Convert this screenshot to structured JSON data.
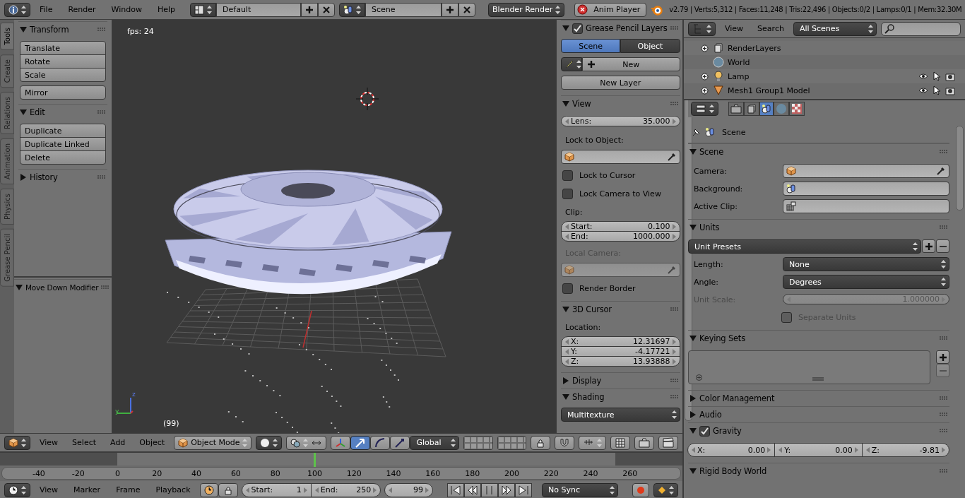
{
  "top_bar": {
    "menus": [
      "File",
      "Render",
      "Window",
      "Help"
    ],
    "layout": "Default",
    "scene": "Scene",
    "engine": "Blender Render",
    "player_button": "Anim Player",
    "stats": "v2.79 | Verts:5,312 | Faces:11,248 | Tris:22,496 | Objects:0/2 | Lamps:0/1 | Mem:32.30M"
  },
  "shelf_tabs": [
    {
      "label": "Tools",
      "selected": true
    },
    {
      "label": "Create",
      "selected": false
    },
    {
      "label": "Relations",
      "selected": false
    },
    {
      "label": "Animation",
      "selected": false
    },
    {
      "label": "Physics",
      "selected": false
    },
    {
      "label": "Grease Pencil",
      "selected": false
    }
  ],
  "tool_shelf": [
    {
      "title": "Transform",
      "expanded": true,
      "groups": [
        [
          "Translate",
          "Rotate",
          "Scale"
        ],
        [
          "Mirror"
        ]
      ]
    },
    {
      "title": "Edit",
      "expanded": true,
      "groups": [
        [
          "Duplicate",
          "Duplicate Linked",
          "Delete"
        ]
      ]
    },
    {
      "title": "History",
      "expanded": false
    }
  ],
  "operator_panel": {
    "title": "Move Down Modifier",
    "expanded": true
  },
  "viewport": {
    "fps": "fps: 24",
    "frame_label": "(99)",
    "axis_labels": [
      "z",
      "y"
    ]
  },
  "n_panel": [
    {
      "title": "Grease Pencil Layers",
      "expanded": true,
      "checked": true,
      "rows": [
        {
          "kind": "tabs",
          "tabs": [
            {
              "label": "Scene",
              "selected": true
            },
            {
              "label": "Object",
              "selected": false
            }
          ]
        },
        {
          "kind": "new",
          "text": "New"
        },
        {
          "kind": "button",
          "text": "New Layer"
        }
      ]
    },
    {
      "title": "View",
      "expanded": true,
      "rows": [
        {
          "kind": "numbers",
          "items": [
            {
              "label": "Lens:",
              "value": "35.000"
            }
          ]
        },
        {
          "kind": "label",
          "text": "Lock to Object:",
          "disabled": false
        },
        {
          "kind": "object",
          "disabled": false
        },
        {
          "kind": "checkbox",
          "label": "Lock to Cursor",
          "checked": false,
          "disabled": false
        },
        {
          "kind": "checkbox",
          "label": "Lock Camera to View",
          "checked": false,
          "disabled": false
        },
        {
          "kind": "label",
          "text": "Clip:",
          "disabled": false
        },
        {
          "kind": "numbers",
          "items": [
            {
              "label": "Start:",
              "value": "0.100"
            },
            {
              "label": "End:",
              "value": "1000.000"
            }
          ]
        },
        {
          "kind": "label",
          "text": "Local Camera:",
          "disabled": true
        },
        {
          "kind": "object",
          "disabled": true
        },
        {
          "kind": "checkbox",
          "label": "Render Border",
          "checked": false,
          "disabled": false
        }
      ]
    },
    {
      "title": "3D Cursor",
      "expanded": true,
      "rows": [
        {
          "kind": "label",
          "text": "Location:",
          "disabled": false
        },
        {
          "kind": "numbers",
          "items": [
            {
              "label": "X:",
              "value": "12.31697"
            },
            {
              "label": "Y:",
              "value": "-4.17721"
            },
            {
              "label": "Z:",
              "value": "13.93888"
            }
          ]
        }
      ]
    },
    {
      "title": "Display",
      "expanded": false
    },
    {
      "title": "Shading",
      "expanded": true,
      "rows": [
        {
          "kind": "dropdown",
          "value": "Multitexture"
        }
      ]
    }
  ],
  "view3d_header": {
    "menus": [
      "View",
      "Select",
      "Add",
      "Object"
    ],
    "mode": "Object Mode",
    "orientation": "Global"
  },
  "timeline": {
    "ticks": [
      "-40",
      "-20",
      "0",
      "20",
      "40",
      "60",
      "80",
      "100",
      "120",
      "140",
      "160",
      "180",
      "200",
      "220",
      "240",
      "260"
    ],
    "playhead": {
      "level": 0.46
    }
  },
  "timeline_header": {
    "menus": [
      "View",
      "Marker",
      "Frame",
      "Playback"
    ],
    "start": {
      "label": "Start:",
      "value": "1"
    },
    "end": {
      "label": "End:",
      "value": "250"
    },
    "current": "99",
    "sync": "No Sync"
  },
  "outliner": {
    "menus": [
      "View",
      "Search"
    ],
    "filter": "All Scenes",
    "items": [
      {
        "label": "RenderLayers",
        "kind": "render_layers",
        "expandable": true,
        "restrict": false
      },
      {
        "label": "World",
        "kind": "world",
        "expandable": false,
        "restrict": false
      },
      {
        "label": "Lamp",
        "kind": "lamp",
        "expandable": true,
        "restrict": true
      },
      {
        "label": "Mesh1 Group1 Model",
        "kind": "mesh",
        "expandable": true,
        "restrict": true
      }
    ]
  },
  "properties": {
    "tabs": [
      {
        "kind": "render",
        "selected": false
      },
      {
        "kind": "render_layers",
        "selected": false
      },
      {
        "kind": "scene",
        "selected": true
      },
      {
        "kind": "world",
        "selected": false
      },
      {
        "kind": "texture",
        "selected": false
      }
    ],
    "context": "Scene",
    "sections": [
      {
        "title": "Scene",
        "expanded": true,
        "rows": [
          {
            "kind": "object",
            "label": "Camera:",
            "disabled": false
          },
          {
            "kind": "scene_field",
            "label": "Background:"
          },
          {
            "kind": "clip_field",
            "label": "Active Clip:"
          }
        ]
      },
      {
        "title": "Units",
        "expanded": true,
        "rows": [
          {
            "kind": "presets",
            "value": "Unit Presets"
          },
          {
            "kind": "dropdown",
            "label": "Length:",
            "value": "None"
          },
          {
            "kind": "dropdown",
            "label": "Angle:",
            "value": "Degrees"
          },
          {
            "kind": "numbers",
            "label": "Unit Scale:",
            "disabled": true,
            "items": [
              {
                "value": "1.000000"
              }
            ]
          },
          {
            "kind": "checkbox",
            "label": "Separate Units",
            "checked": false,
            "disabled": true
          }
        ]
      },
      {
        "title": "Keying Sets",
        "expanded": true,
        "rows": [
          {
            "kind": "list"
          }
        ]
      },
      {
        "title": "Color Management",
        "expanded": false
      },
      {
        "title": "Audio",
        "expanded": false
      },
      {
        "title": "Gravity",
        "expanded": true,
        "checked": true,
        "rows": [
          {
            "kind": "vector",
            "items": [
              {
                "label": "X:",
                "value": "0.00"
              },
              {
                "label": "Y:",
                "value": "0.00"
              },
              {
                "label": "Z:",
                "value": "-9.81"
              }
            ]
          }
        ]
      },
      {
        "title": "Rigid Body World",
        "expanded": true
      }
    ]
  }
}
